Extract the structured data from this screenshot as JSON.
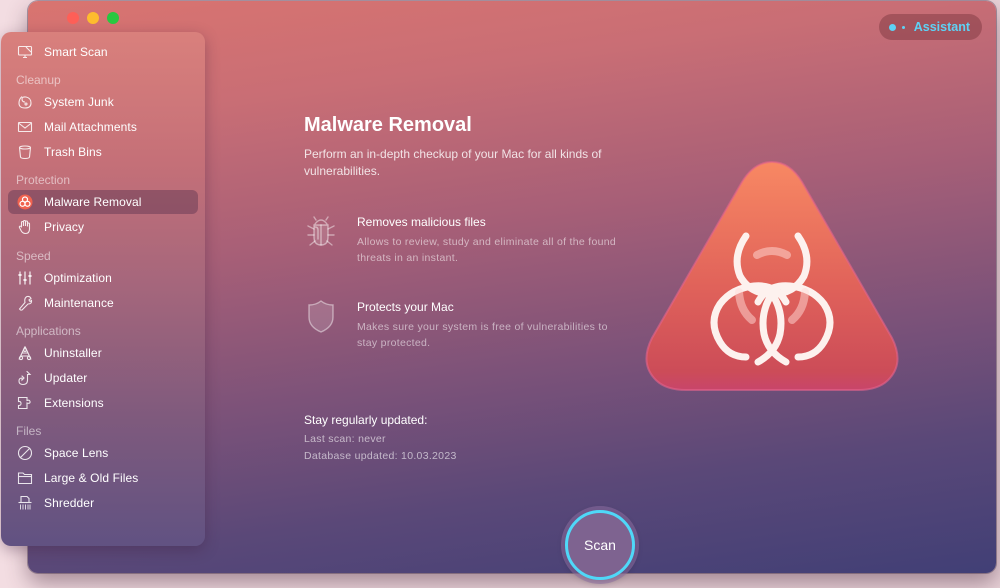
{
  "window": {
    "traffic_lights": [
      "close",
      "minimize",
      "zoom"
    ]
  },
  "assistant": {
    "label": "Assistant",
    "icon": "assistant-dots-icon",
    "color": "#5ed2f5"
  },
  "sidebar": {
    "items": [
      {
        "label": "Smart Scan",
        "icon": "display-icon"
      },
      {
        "section": "Cleanup"
      },
      {
        "label": "System Junk",
        "icon": "disk-icon"
      },
      {
        "label": "Mail Attachments",
        "icon": "envelope-icon"
      },
      {
        "label": "Trash Bins",
        "icon": "bin-icon"
      },
      {
        "section": "Protection"
      },
      {
        "label": "Malware Removal",
        "icon": "biohazard-icon",
        "active": true
      },
      {
        "label": "Privacy",
        "icon": "hand-icon"
      },
      {
        "section": "Speed"
      },
      {
        "label": "Optimization",
        "icon": "sliders-icon"
      },
      {
        "label": "Maintenance",
        "icon": "wrench-icon"
      },
      {
        "section": "Applications"
      },
      {
        "label": "Uninstaller",
        "icon": "app-uninstall-icon"
      },
      {
        "label": "Updater",
        "icon": "update-arrow-icon"
      },
      {
        "label": "Extensions",
        "icon": "puzzle-icon"
      },
      {
        "section": "Files"
      },
      {
        "label": "Space Lens",
        "icon": "planet-icon"
      },
      {
        "label": "Large & Old Files",
        "icon": "folder-icon"
      },
      {
        "label": "Shredder",
        "icon": "shredder-icon"
      }
    ]
  },
  "main": {
    "title": "Malware Removal",
    "subtitle": "Perform an in-depth checkup of your Mac for all kinds of vulnerabilities.",
    "features": [
      {
        "icon": "bug-icon",
        "title": "Removes malicious files",
        "desc": "Allows to review, study and eliminate all of the found threats in an instant."
      },
      {
        "icon": "shield-icon",
        "title": "Protects your Mac",
        "desc": "Makes sure your system is free of vulnerabilities to stay protected."
      }
    ],
    "updates": {
      "title": "Stay regularly updated:",
      "last_scan": "Last scan: never",
      "database": "Database updated: 10.03.2023"
    },
    "hero_icon": "biohazard-triangle-icon",
    "scan_button": "Scan",
    "accent": "#4fd8f8"
  }
}
